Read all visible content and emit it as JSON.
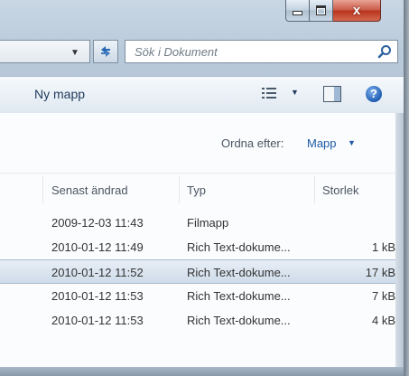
{
  "window": {
    "caption": {
      "minimize_icon": "minimize-icon",
      "maximize_icon": "maximize-icon",
      "close_icon": "close-icon",
      "close_glyph": "x"
    }
  },
  "address_bar": {
    "dropdown_icon": "chevron-down-icon",
    "refresh_icon": "refresh-icon"
  },
  "search": {
    "placeholder": "Sök i Dokument",
    "icon": "search-icon"
  },
  "toolbar": {
    "new_folder_label": "Ny mapp",
    "views_icon": "views-list-icon",
    "views_dropdown_icon": "chevron-down-icon",
    "preview_pane_icon": "preview-pane-icon",
    "help_glyph": "?",
    "help_icon": "help-icon"
  },
  "sort": {
    "label": "Ordna efter:",
    "value": "Mapp",
    "dropdown_icon": "chevron-down-icon"
  },
  "columns": {
    "date": "Senast ändrad",
    "type": "Typ",
    "size": "Storlek"
  },
  "files": [
    {
      "date": "2009-12-03 11:43",
      "type": "Filmapp",
      "size": "",
      "selected": false
    },
    {
      "date": "2010-01-12 11:49",
      "type": "Rich Text-dokume...",
      "size": "1 kB",
      "selected": false
    },
    {
      "date": "2010-01-12 11:52",
      "type": "Rich Text-dokume...",
      "size": "17 kB",
      "selected": true
    },
    {
      "date": "2010-01-12 11:53",
      "type": "Rich Text-dokume...",
      "size": "7 kB",
      "selected": false
    },
    {
      "date": "2010-01-12 11:53",
      "type": "Rich Text-dokume...",
      "size": "4 kB",
      "selected": false
    }
  ]
}
